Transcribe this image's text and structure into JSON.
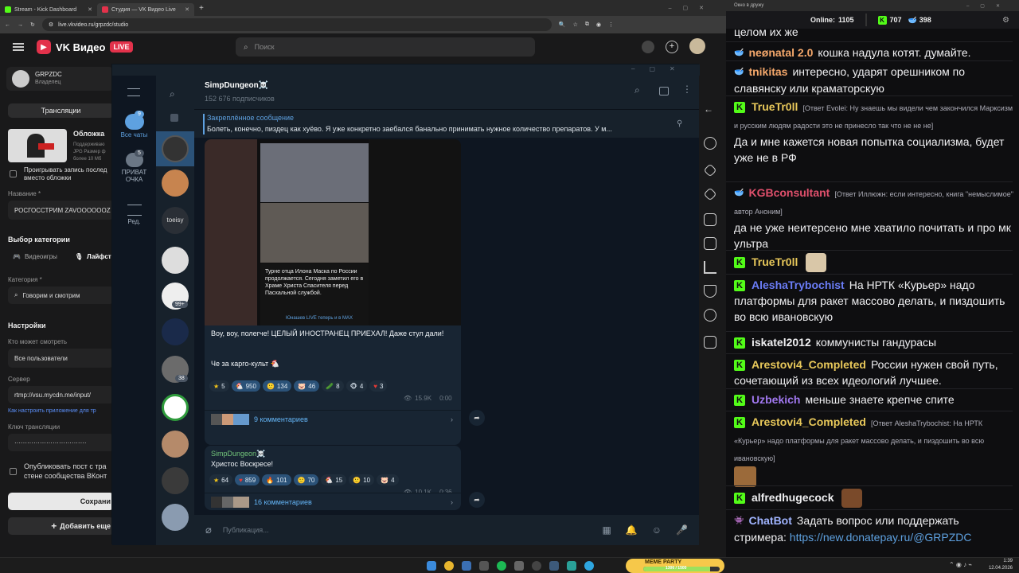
{
  "browser": {
    "tabs": [
      {
        "title": "Stream - Kick Dashboard",
        "color": "#53fc18"
      },
      {
        "title": "Студия — VK Видео Live",
        "color": "#e3324b"
      }
    ],
    "url": "live.vkvideo.ru/grpzdc/studio"
  },
  "vk": {
    "logo_text": "VK Видео",
    "live_badge": "LIVE",
    "search_placeholder": "Поиск",
    "channel_name": "GRPZDC",
    "channel_role": "Владелец",
    "broadcasts_btn": "Трансляции",
    "cover_label": "Обложка",
    "cover_hint1": "Поддерживаю",
    "cover_hint2": "JPG Размер ф",
    "cover_hint3": "более 10 Мб",
    "play_record_1": "Проигрывать запись послед",
    "play_record_2": "вместо обложки",
    "name_label": "Название *",
    "name_value": "РОСГОССТРИМ ZAVOOOOOOZ",
    "category_choice": "Выбор категории",
    "cat_games": "Видеоигры",
    "cat_life": "Лайфст",
    "category_label": "Категория *",
    "category_value": "Говорим и смотрим",
    "settings": "Настройки",
    "who_watch": "Кто может смотреть",
    "who_value": "Все пользователи",
    "server_label": "Сервер",
    "server_value": "rtmp://vsu.mycdn.me/input/",
    "howto_link": "Как настроить приложение для тр",
    "key_label": "Ключ трансляции",
    "key_value": "··································",
    "publish_1": "Опубликовать пост с тра",
    "publish_2": "стене сообщества ВКонт",
    "save_btn": "Сохрани",
    "add_btn": "Добавить еще"
  },
  "tg": {
    "folders": [
      {
        "label": "Все чаты",
        "badge": "9"
      },
      {
        "label": "ПРИВАТ ОЧКА",
        "badge": "5"
      },
      {
        "label": "Ред.",
        "badge": ""
      }
    ],
    "chat_badges": [
      "99+",
      "38"
    ],
    "list_label": "toeisy",
    "channel_title": "SimpDungeon☠️",
    "subscribers": "152 676 подписчиков",
    "pinned_title": "Закреплённое сообщение",
    "pinned_text": "Болеть, конечно, пиздец как хуёво. Я уже конкретно заебался банально принимать нужное количество препаратов. У м...",
    "photo_caption": "Турне отца Илона Маска по России продолжается. Сегодня заметил его в Храме Христа Спасителя перед Пасхальной службой.",
    "photo_source": "Юнашев LIVE теперь и в MAX",
    "msg1_text1": "Воу, воу, полегче! ЦЕЛЫЙ ИНОСТРАНЕЦ ПРИЕХАЛ! Даже стул дали!",
    "msg1_text2": "Че за карго-культ 🐔",
    "msg1_reactions": [
      {
        "icon": "★",
        "count": "5"
      },
      {
        "icon": "🐔",
        "count": "950"
      },
      {
        "icon": "🙂",
        "count": "134"
      },
      {
        "icon": "🐷",
        "count": "46"
      },
      {
        "icon": "🥒",
        "count": "8"
      },
      {
        "icon": "🐵",
        "count": "4"
      },
      {
        "icon": "♥",
        "count": "3"
      }
    ],
    "msg1_views": "15.9K",
    "msg1_time": "0:00",
    "msg1_comments": "9 комментариев",
    "msg2_author": "SimpDungeon☠️",
    "msg2_text": "Христос Воскресе!",
    "msg2_reactions": [
      {
        "icon": "★",
        "count": "64"
      },
      {
        "icon": "♥",
        "count": "859"
      },
      {
        "icon": "🔥",
        "count": "101"
      },
      {
        "icon": "🙂",
        "count": "70"
      },
      {
        "icon": "🐔",
        "count": "15"
      },
      {
        "icon": "🙂",
        "count": "10"
      },
      {
        "icon": "🐷",
        "count": "4"
      }
    ],
    "msg2_views": "10.1K",
    "msg2_time": "0:36",
    "msg2_comments": "16 комментариев",
    "composer_placeholder": "Публикация..."
  },
  "chat": {
    "window_title": "Окно в дружу",
    "online_label": "Online:",
    "online_count": "1105",
    "kick_count": "707",
    "hat_count": "398",
    "messages": [
      {
        "badge": "",
        "nick": "",
        "nick_color": "#efeff1",
        "reply": "",
        "text": "целом их же"
      },
      {
        "badge": "hat",
        "nick": "neønatal 2.0",
        "nick_color": "#f5a86b",
        "reply": "",
        "text": "кошка надула котят. думайте."
      },
      {
        "badge": "hat",
        "nick": "tnikitas",
        "nick_color": "#f5a86b",
        "reply": "",
        "text": "интересно, ударят орешником по славянску или краматорскую"
      },
      {
        "badge": "kick",
        "nick": "TrueTr0ll",
        "nick_color": "#e8c85a",
        "reply": "[Ответ Evolei: Ну знаешь мы видели чем закончился Марксизм и русским людям радости это не принесло так что не не не]",
        "text": "Да и мне кажется новая попытка социализма, будет уже не в РФ"
      },
      {
        "badge": "hat",
        "nick": "KGBconsultant",
        "nick_color": "#e0506c",
        "reply": "[Ответ Иллюжн: если интересно, книга \"немыслимое\" автор Аноним]",
        "text": "да не уже неитерсено мне хватило почитать и про мк ультра"
      },
      {
        "badge": "kick",
        "nick": "TrueTr0ll",
        "nick_color": "#e8c85a",
        "reply": "",
        "text": ""
      },
      {
        "badge": "kick",
        "nick": "AleshaTrybochist",
        "nick_color": "#6a7cf5",
        "reply": "",
        "text": "На НРТК «Курьер» надо платформы для ракет массово делать, и пиздошить во всю ивановскую"
      },
      {
        "badge": "kick",
        "nick": "iskatel2012",
        "nick_color": "#efeff1",
        "reply": "",
        "text": "коммунисты гандурасы"
      },
      {
        "badge": "kick",
        "nick": "Arestovi4_Completed",
        "nick_color": "#e8c85a",
        "reply": "",
        "text": "России нужен свой путь, сочетающий из всех идеологий лучшее."
      },
      {
        "badge": "kick",
        "nick": "Uzbekich",
        "nick_color": "#a178f0",
        "reply": "",
        "text": "меньше знаете крепче спите"
      },
      {
        "badge": "kick",
        "nick": "Arestovi4_Completed",
        "nick_color": "#e8c85a",
        "reply": "[Ответ AleshaTrybochist: На НРТК «Курьер» надо платформы для ракет массово делать, и пиздошить во всю ивановскую]",
        "text": ""
      },
      {
        "badge": "kick",
        "nick": "alfredhugecock",
        "nick_color": "#efeff1",
        "reply": "",
        "text": ""
      },
      {
        "badge": "bot",
        "nick": "ChatBot",
        "nick_color": "#a0b4ff",
        "reply": "",
        "text": "Задать вопрос или поддержать стримера:",
        "link": "https://new.donatepay.ru/@GRPZDC"
      }
    ]
  },
  "taskbar": {
    "time": "1:39",
    "date": "12.04.2026",
    "widget_label": "MEME PARTY",
    "widget_progress": "1306 / 1500"
  }
}
